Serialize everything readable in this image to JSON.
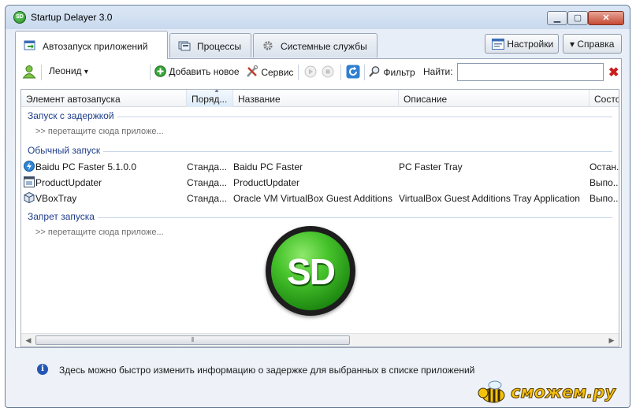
{
  "window": {
    "title": "Startup Delayer 3.0",
    "logo_text": "SD",
    "minimize": "▁",
    "maximize": "▢",
    "close": "✕"
  },
  "tabs": [
    {
      "label": "Автозапуск приложений",
      "icon": "startup-icon",
      "active": true
    },
    {
      "label": "Процессы",
      "icon": "processes-icon",
      "active": false
    },
    {
      "label": "Системные службы",
      "icon": "services-gear-icon",
      "active": false
    }
  ],
  "header_buttons": {
    "settings": "Настройки",
    "help": "Справка",
    "help_arrow": "▾"
  },
  "toolbar": {
    "user": "Леонид",
    "user_arrow": "▾",
    "add_new": "Добавить новое",
    "service": "Сервис",
    "filter": "Фильтр",
    "search_label": "Найти:",
    "search_value": "",
    "clear": "✖"
  },
  "columns": [
    "Элемент автозапуска",
    "Поряд...",
    "Название",
    "Описание",
    "Состо..."
  ],
  "groups": {
    "delayed": {
      "label": "Запуск с задержкой",
      "hint": ">> перетащите сюда приложе..."
    },
    "normal": {
      "label": "Обычный запуск"
    },
    "blocked": {
      "label": "Запрет запуска",
      "hint": ">> перетащите сюда приложе..."
    }
  },
  "rows": [
    {
      "item": "Baidu PC Faster 5.1.0.0",
      "order": "Станда...",
      "name": "Baidu PC Faster",
      "description": "PC Faster Tray",
      "state": "Остан...",
      "icon": "baidu-icon"
    },
    {
      "item": "ProductUpdater",
      "order": "Станда...",
      "name": "ProductUpdater",
      "description": "",
      "state": "Выпо...",
      "icon": "app-window-icon"
    },
    {
      "item": "VBoxTray",
      "order": "Станда...",
      "name": "Oracle VM VirtualBox Guest Additions",
      "description": "VirtualBox Guest Additions Tray Application",
      "state": "Выпо...",
      "icon": "virtualbox-icon"
    }
  ],
  "watermark_logo": {
    "text": "SD"
  },
  "info": {
    "text": "Здесь можно быстро изменить информацию о задержке для выбранных в списке приложений"
  },
  "site_watermark": "сможем.ру",
  "colors": {
    "accent_green": "#1f8a1f",
    "group_text": "#1e3e8c",
    "clear_red": "#cc1b1b"
  }
}
